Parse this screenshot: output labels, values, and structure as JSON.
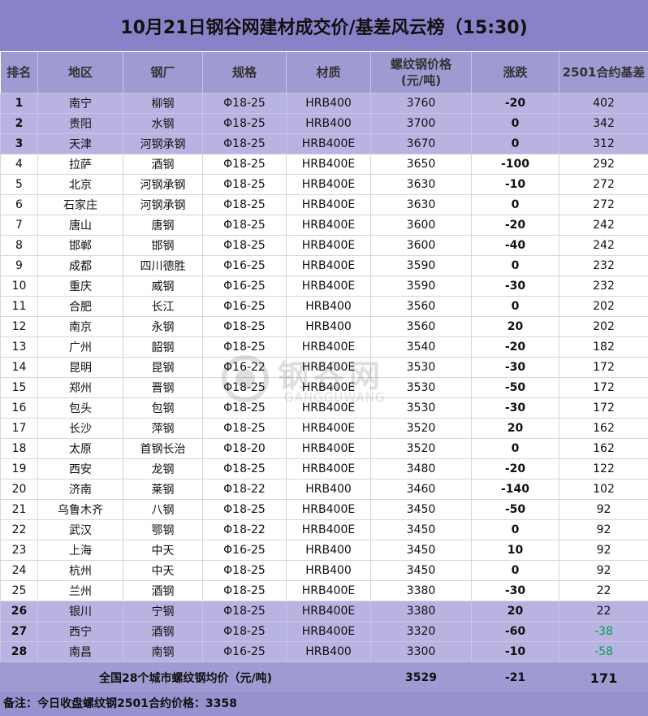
{
  "title": "10月21日钢谷网建材成交价/基差风云榜（15:30)",
  "headers": {
    "rank": "排名",
    "region": "地区",
    "mill": "钢厂",
    "spec": "规格",
    "material": "材质",
    "price_line1": "螺纹钢价格",
    "price_line2": "(元/吨)",
    "change": "涨跌",
    "basis": "2501合约基差"
  },
  "rows": [
    {
      "rank": "1",
      "region": "南宁",
      "mill": "柳钢",
      "spec": "Φ18-25",
      "material": "HRB400",
      "price": "3760",
      "change": "-20",
      "basis": "402"
    },
    {
      "rank": "2",
      "region": "贵阳",
      "mill": "水钢",
      "spec": "Φ18-25",
      "material": "HRB400",
      "price": "3700",
      "change": "0",
      "basis": "342"
    },
    {
      "rank": "3",
      "region": "天津",
      "mill": "河钢承钢",
      "spec": "Φ18-25",
      "material": "HRB400E",
      "price": "3670",
      "change": "0",
      "basis": "312"
    },
    {
      "rank": "4",
      "region": "拉萨",
      "mill": "酒钢",
      "spec": "Φ18-25",
      "material": "HRB400E",
      "price": "3650",
      "change": "-100",
      "basis": "292"
    },
    {
      "rank": "5",
      "region": "北京",
      "mill": "河钢承钢",
      "spec": "Φ18-25",
      "material": "HRB400E",
      "price": "3630",
      "change": "-10",
      "basis": "272"
    },
    {
      "rank": "6",
      "region": "石家庄",
      "mill": "河钢承钢",
      "spec": "Φ18-25",
      "material": "HRB400E",
      "price": "3630",
      "change": "0",
      "basis": "272"
    },
    {
      "rank": "7",
      "region": "唐山",
      "mill": "唐钢",
      "spec": "Φ18-25",
      "material": "HRB400E",
      "price": "3600",
      "change": "-20",
      "basis": "242"
    },
    {
      "rank": "8",
      "region": "邯郸",
      "mill": "邯钢",
      "spec": "Φ18-25",
      "material": "HRB400E",
      "price": "3600",
      "change": "-40",
      "basis": "242"
    },
    {
      "rank": "9",
      "region": "成都",
      "mill": "四川德胜",
      "spec": "Φ16-25",
      "material": "HRB400E",
      "price": "3590",
      "change": "0",
      "basis": "232"
    },
    {
      "rank": "10",
      "region": "重庆",
      "mill": "威钢",
      "spec": "Φ16-25",
      "material": "HRB400E",
      "price": "3590",
      "change": "-30",
      "basis": "232"
    },
    {
      "rank": "11",
      "region": "合肥",
      "mill": "长江",
      "spec": "Φ16-25",
      "material": "HRB400",
      "price": "3560",
      "change": "0",
      "basis": "202"
    },
    {
      "rank": "12",
      "region": "南京",
      "mill": "永钢",
      "spec": "Φ18-25",
      "material": "HRB400",
      "price": "3560",
      "change": "20",
      "basis": "202"
    },
    {
      "rank": "13",
      "region": "广州",
      "mill": "韶钢",
      "spec": "Φ18-25",
      "material": "HRB400E",
      "price": "3540",
      "change": "-20",
      "basis": "182"
    },
    {
      "rank": "14",
      "region": "昆明",
      "mill": "昆钢",
      "spec": "Φ16-22",
      "material": "HRB400E",
      "price": "3530",
      "change": "-30",
      "basis": "172"
    },
    {
      "rank": "15",
      "region": "郑州",
      "mill": "晋钢",
      "spec": "Φ18-25",
      "material": "HRB400E",
      "price": "3530",
      "change": "-50",
      "basis": "172"
    },
    {
      "rank": "16",
      "region": "包头",
      "mill": "包钢",
      "spec": "Φ18-25",
      "material": "HRB400E",
      "price": "3530",
      "change": "-30",
      "basis": "172"
    },
    {
      "rank": "17",
      "region": "长沙",
      "mill": "萍钢",
      "spec": "Φ18-25",
      "material": "HRB400E",
      "price": "3520",
      "change": "20",
      "basis": "162"
    },
    {
      "rank": "18",
      "region": "太原",
      "mill": "首钢长治",
      "spec": "Φ18-20",
      "material": "HRB400E",
      "price": "3520",
      "change": "0",
      "basis": "162"
    },
    {
      "rank": "19",
      "region": "西安",
      "mill": "龙钢",
      "spec": "Φ18-25",
      "material": "HRB400E",
      "price": "3480",
      "change": "-20",
      "basis": "122"
    },
    {
      "rank": "20",
      "region": "济南",
      "mill": "莱钢",
      "spec": "Φ18-22",
      "material": "HRB400",
      "price": "3460",
      "change": "-140",
      "basis": "102"
    },
    {
      "rank": "21",
      "region": "乌鲁木齐",
      "mill": "八钢",
      "spec": "Φ18-25",
      "material": "HRB400E",
      "price": "3450",
      "change": "-50",
      "basis": "92"
    },
    {
      "rank": "22",
      "region": "武汉",
      "mill": "鄂钢",
      "spec": "Φ18-22",
      "material": "HRB400E",
      "price": "3450",
      "change": "0",
      "basis": "92"
    },
    {
      "rank": "23",
      "region": "上海",
      "mill": "中天",
      "spec": "Φ16-25",
      "material": "HRB400",
      "price": "3450",
      "change": "10",
      "basis": "92"
    },
    {
      "rank": "24",
      "region": "杭州",
      "mill": "中天",
      "spec": "Φ18-25",
      "material": "HRB400",
      "price": "3450",
      "change": "0",
      "basis": "92"
    },
    {
      "rank": "25",
      "region": "兰州",
      "mill": "酒钢",
      "spec": "Φ18-25",
      "material": "HRB400E",
      "price": "3380",
      "change": "-30",
      "basis": "22"
    },
    {
      "rank": "26",
      "region": "银川",
      "mill": "宁钢",
      "spec": "Φ18-25",
      "material": "HRB400E",
      "price": "3380",
      "change": "20",
      "basis": "22"
    },
    {
      "rank": "27",
      "region": "西宁",
      "mill": "酒钢",
      "spec": "Φ18-25",
      "material": "HRB400E",
      "price": "3320",
      "change": "-60",
      "basis": "-38"
    },
    {
      "rank": "28",
      "region": "南昌",
      "mill": "南钢",
      "spec": "Φ16-25",
      "material": "HRB400",
      "price": "3300",
      "change": "-10",
      "basis": "-58"
    }
  ],
  "highlighted_ranks": [
    "1",
    "2",
    "3",
    "26",
    "27",
    "28"
  ],
  "average": {
    "label": "全国28个城市螺纹钢均价（元/吨)",
    "price": "3529",
    "change": "-21",
    "basis": "171"
  },
  "note": "备注：今日收盘螺纹钢2501合约价格：3358",
  "watermark": {
    "cn": "钢谷网",
    "en": "GANGGUWANG"
  },
  "colors": {
    "header_bg": "#a09ad2",
    "highlight_bg": "#b8b3e0",
    "up": "#e60012",
    "down": "#00a050"
  }
}
